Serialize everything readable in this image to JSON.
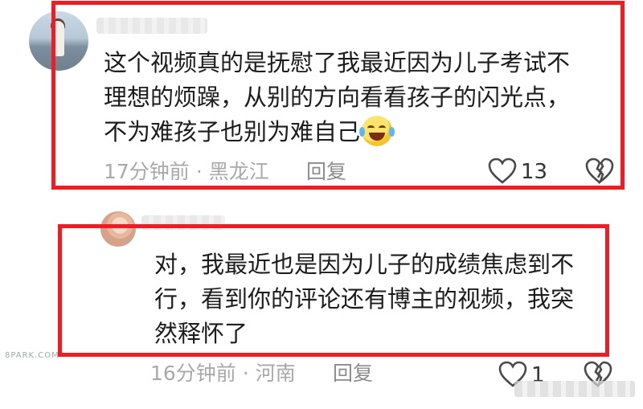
{
  "comments": [
    {
      "text_line1": "这个视频真的是抚慰了我最近因为儿子考试不",
      "text_line2": "理想的烦躁，从别的方向看看孩子的闪光点，",
      "text_line3": "不为难孩子也别为难自己",
      "emoji": "crying-laughing-emoji",
      "time": "17分钟前",
      "location": "黑龙江",
      "reply_label": "回复",
      "likes": "13"
    },
    {
      "text_line1": "对，我最近也是因为儿子的成绩焦虑到不",
      "text_line2": "行，看到你的评论还有博主的视频，我突",
      "text_line3": "然释怀了",
      "time": "16分钟前",
      "location": "河南",
      "reply_label": "回复",
      "likes": "1"
    }
  ],
  "separator": "·",
  "highlight_color": "#ee1c25",
  "watermark_left": "8PARK.COM"
}
